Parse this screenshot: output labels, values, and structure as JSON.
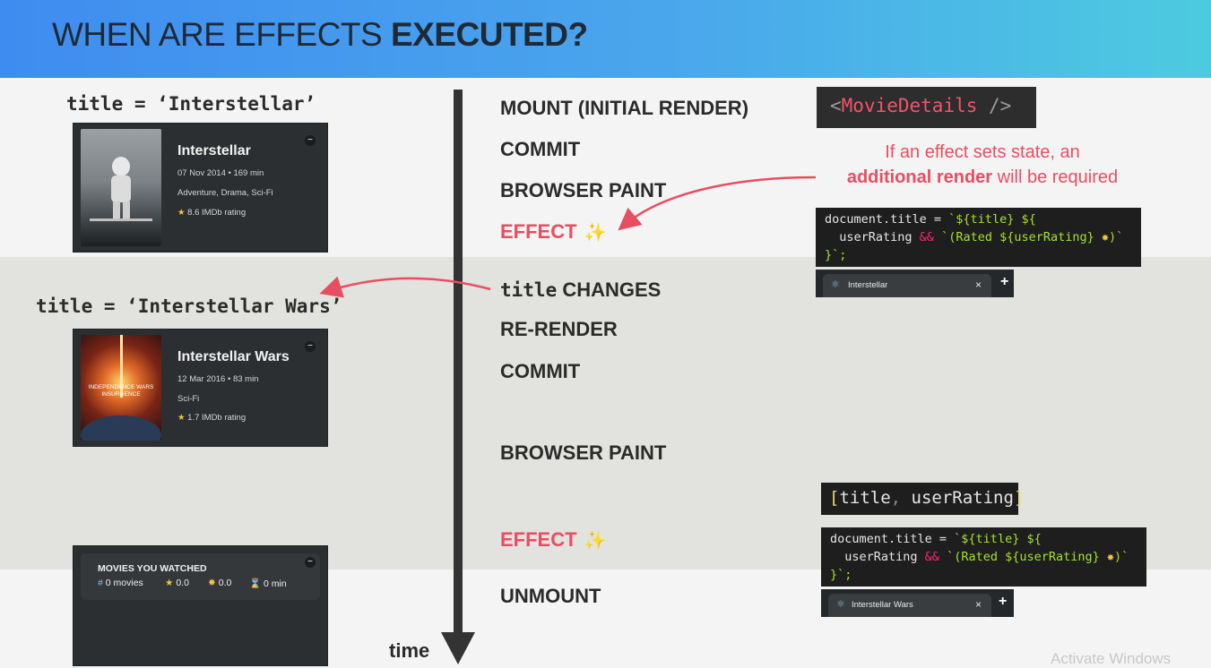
{
  "header": {
    "title_plain": "WHEN ARE EFFECTS ",
    "title_bold": "EXECUTED?",
    "gradient_start": "#3f8cf0",
    "gradient_end": "#4ccbe0"
  },
  "left": {
    "title_assign_1": "title = ‘Interstellar’",
    "title_assign_2": "title = ‘Interstellar Wars’",
    "movie_1": {
      "title": "Interstellar",
      "meta": "07 Nov 2014 • 169 min",
      "genre": "Adventure, Drama, Sci-Fi",
      "rating": "8.6 IMDb rating"
    },
    "movie_2": {
      "title": "Interstellar Wars",
      "meta": "12 Mar 2016 • 83 min",
      "genre": "Sci-Fi",
      "rating": "1.7 IMDb rating"
    },
    "watched": {
      "heading": "MOVIES YOU WATCHED",
      "movies": "0 movies",
      "imdb": "0.0",
      "user": "0.0",
      "runtime": "0 min"
    }
  },
  "timeline": {
    "label": "time",
    "steps": {
      "mount": "MOUNT (INITIAL RENDER)",
      "commit_1": "COMMIT",
      "paint_1": "BROWSER PAINT",
      "effect_1": "EFFECT",
      "title_changes_code": "title",
      "title_changes_text": " CHANGES",
      "rerender": "RE-RENDER",
      "commit_2": "COMMIT",
      "paint_2": "BROWSER PAINT",
      "effect_2": "EFFECT",
      "unmount": "UNMOUNT"
    },
    "sparkle_icon": "✨"
  },
  "right": {
    "component": "MovieDetails",
    "note_line_1": "If an effect sets state, an",
    "note_bold": "additional render",
    "note_line_2_rest": " will be required",
    "dependency_array": {
      "open": "[",
      "items": [
        "title",
        "userRating"
      ],
      "close": "]"
    },
    "tab_1": "Interstellar",
    "tab_2": "Interstellar Wars",
    "tab_close": "×",
    "tab_add": "+"
  },
  "watermark": "Activate Windows",
  "colors": {
    "accent_red": "#e84e62",
    "code_bg": "#1e1e1e",
    "card_bg": "#2b2f31",
    "band_gray": "#e2e2de"
  }
}
